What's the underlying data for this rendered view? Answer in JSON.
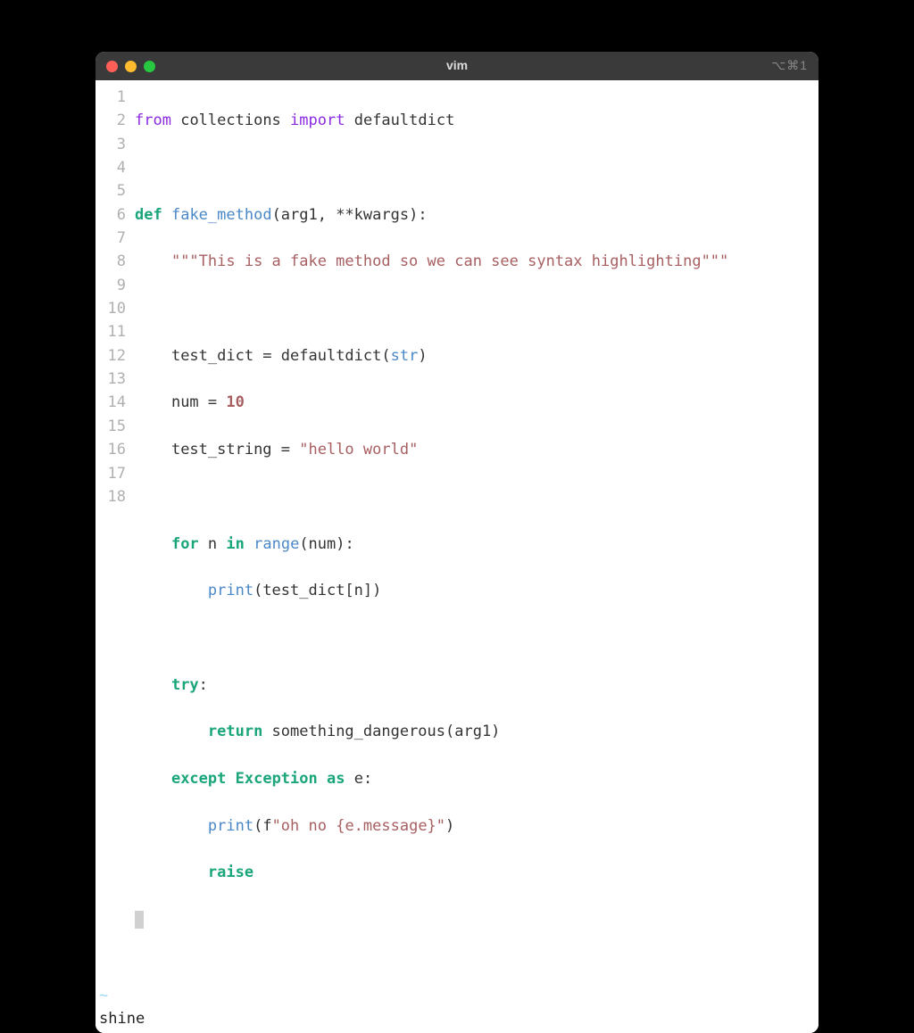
{
  "titlebar": {
    "title": "vim",
    "shortcut_hint": "⌥⌘1"
  },
  "line_numbers": [
    "1",
    "2",
    "3",
    "4",
    "5",
    "6",
    "7",
    "8",
    "9",
    "10",
    "11",
    "12",
    "13",
    "14",
    "15",
    "16",
    "17",
    "18"
  ],
  "code": {
    "l1": {
      "from": "from",
      "mod": "collections",
      "import": "import",
      "name": "defaultdict"
    },
    "l3": {
      "def": "def",
      "fname": "fake_method",
      "sig": "(arg1, **kwargs):"
    },
    "l4": {
      "doc": "\"\"\"This is a fake method so we can see syntax highlighting\"\"\""
    },
    "l6": {
      "lhs": "test_dict = ",
      "fn": "defaultdict",
      "open": "(",
      "arg": "str",
      "close": ")"
    },
    "l7": {
      "lhs": "num = ",
      "num": "10"
    },
    "l8": {
      "lhs": "test_string = ",
      "str": "\"hello world\""
    },
    "l10": {
      "for": "for",
      "var": " n ",
      "in": "in",
      "fn": "range",
      "args": "(num):"
    },
    "l11": {
      "fn": "print",
      "args": "(test_dict[n])"
    },
    "l13": {
      "try": "try",
      "colon": ":"
    },
    "l14": {
      "return": "return",
      "rest": " something_dangerous(arg1)"
    },
    "l15": {
      "except": "except",
      "exc": "Exception",
      "as": "as",
      "var": " e:"
    },
    "l16": {
      "fn": "print",
      "open": "(f",
      "str": "\"oh no {e.message}\"",
      "close": ")"
    },
    "l17": {
      "raise": "raise"
    }
  },
  "tilde": "~",
  "statusline": "shine"
}
